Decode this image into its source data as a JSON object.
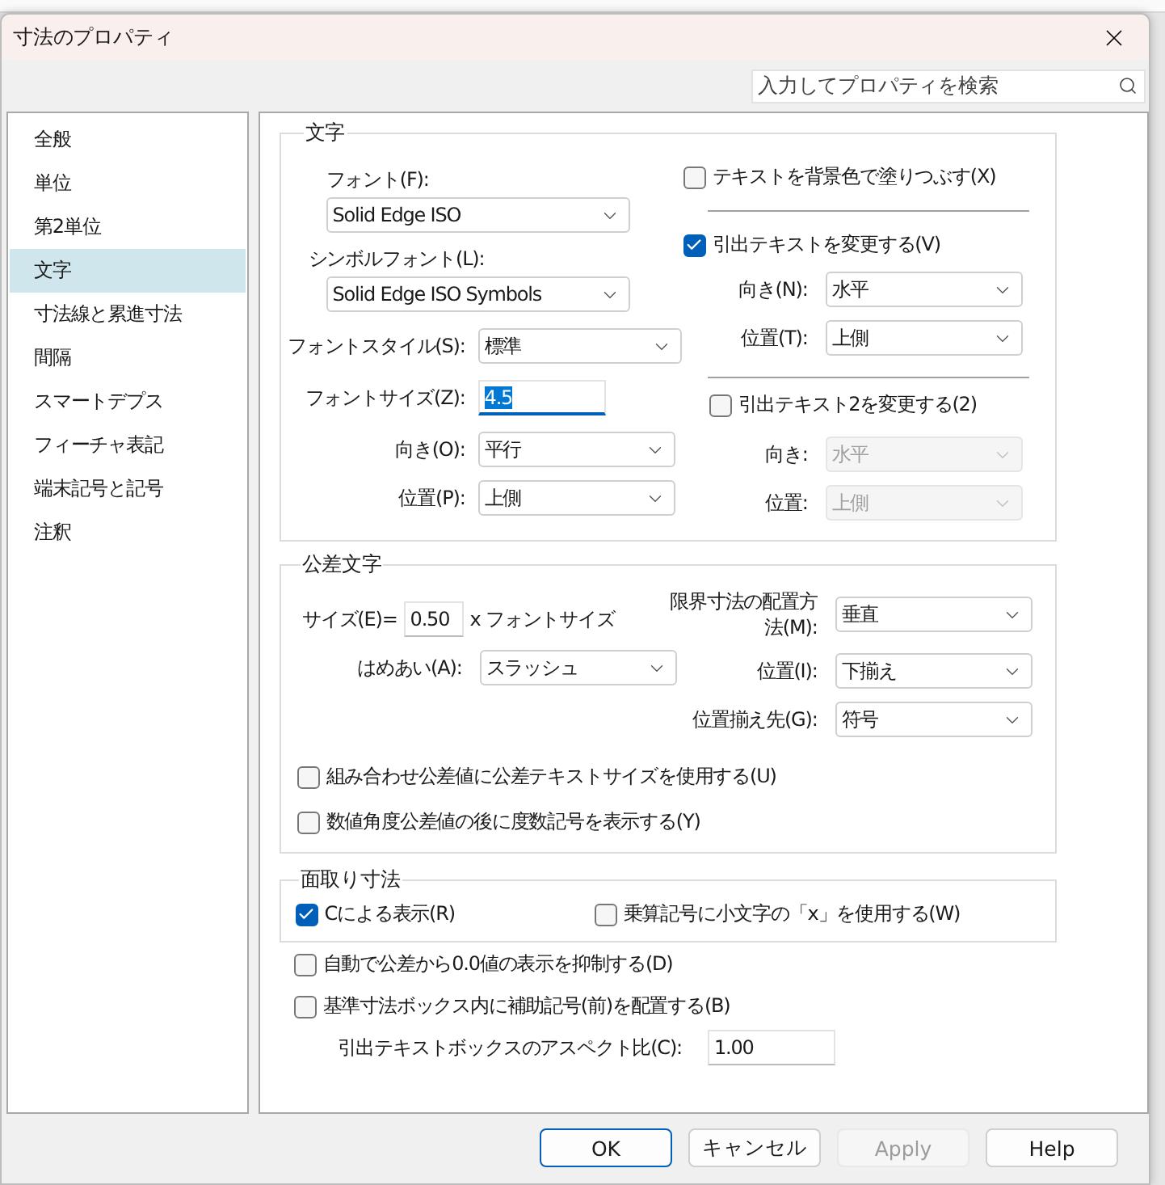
{
  "window": {
    "title": "寸法のプロパティ",
    "search": {
      "placeholder": "入力してプロパティを検索"
    }
  },
  "sidebar": {
    "items": [
      {
        "label": "全般",
        "selected": false
      },
      {
        "label": "単位",
        "selected": false
      },
      {
        "label": "第2単位",
        "selected": false
      },
      {
        "label": "文字",
        "selected": true
      },
      {
        "label": "寸法線と累進寸法",
        "selected": false
      },
      {
        "label": "間隔",
        "selected": false
      },
      {
        "label": "スマートデプス",
        "selected": false
      },
      {
        "label": "フィーチャ表記",
        "selected": false
      },
      {
        "label": "端末記号と記号",
        "selected": false
      },
      {
        "label": "注釈",
        "selected": false
      }
    ]
  },
  "text_group": {
    "title": "文字",
    "font": {
      "label": "フォント(F):",
      "value": "Solid Edge ISO"
    },
    "symbol_font": {
      "label": "シンボルフォント(L):",
      "value": "Solid Edge ISO Symbols"
    },
    "font_style": {
      "label": "フォントスタイル(S):",
      "value": "標準"
    },
    "font_size": {
      "label": "フォントサイズ(Z):",
      "value": "4.5",
      "focused": true
    },
    "direction": {
      "label": "向き(O):",
      "value": "平行"
    },
    "position": {
      "label": "位置(P):",
      "value": "上側"
    },
    "fill_background": {
      "label": "テキストを背景色で塗りつぶす(X)",
      "checked": false
    },
    "leader_text": {
      "label": "引出テキストを変更する(V)",
      "checked": true,
      "direction": {
        "label": "向き(N):",
        "value": "水平",
        "disabled": false
      },
      "position": {
        "label": "位置(T):",
        "value": "上側",
        "disabled": false
      }
    },
    "leader_text2": {
      "label": "引出テキスト2を変更する(2)",
      "checked": false,
      "direction": {
        "label": "向き:",
        "value": "水平",
        "disabled": true
      },
      "position": {
        "label": "位置:",
        "value": "上側",
        "disabled": true
      }
    }
  },
  "tolerance_group": {
    "title": "公差文字",
    "size": {
      "label": "サイズ(E)=",
      "value": "0.50",
      "suffix": "x フォントサイズ"
    },
    "limit_layout": {
      "label": "限界寸法の配置方法(M):",
      "value": "垂直"
    },
    "fit": {
      "label": "はめあい(A):",
      "value": "スラッシュ"
    },
    "position": {
      "label": "位置(I):",
      "value": "下揃え"
    },
    "align_to": {
      "label": "位置揃え先(G):",
      "value": "符号"
    },
    "checkboxes": [
      {
        "label": "組み合わせ公差値に公差テキストサイズを使用する(U)",
        "checked": false
      },
      {
        "label": "数値角度公差値の後に度数記号を表示する(Y)",
        "checked": false
      }
    ]
  },
  "chamfer_group": {
    "title": "面取り寸法",
    "checkboxes": [
      {
        "label": "Cによる表示(R)",
        "checked": true
      },
      {
        "label": "乗算記号に小文字の「x」を使用する(W)",
        "checked": false
      }
    ]
  },
  "options": [
    {
      "label": "自動で公差から0.0値の表示を抑制する(D)",
      "checked": false
    },
    {
      "label": "基準寸法ボックス内に補助記号(前)を配置する(B)",
      "checked": false
    }
  ],
  "aspect_ratio": {
    "label": "引出テキストボックスのアスペクト比(C):",
    "value": "1.00"
  },
  "buttons": [
    {
      "label": "OK",
      "kind": "default",
      "disabled": false
    },
    {
      "label": "キャンセル",
      "kind": "normal",
      "disabled": false
    },
    {
      "label": "Apply",
      "kind": "normal",
      "disabled": true
    },
    {
      "label": "Help",
      "kind": "normal",
      "disabled": false
    }
  ]
}
